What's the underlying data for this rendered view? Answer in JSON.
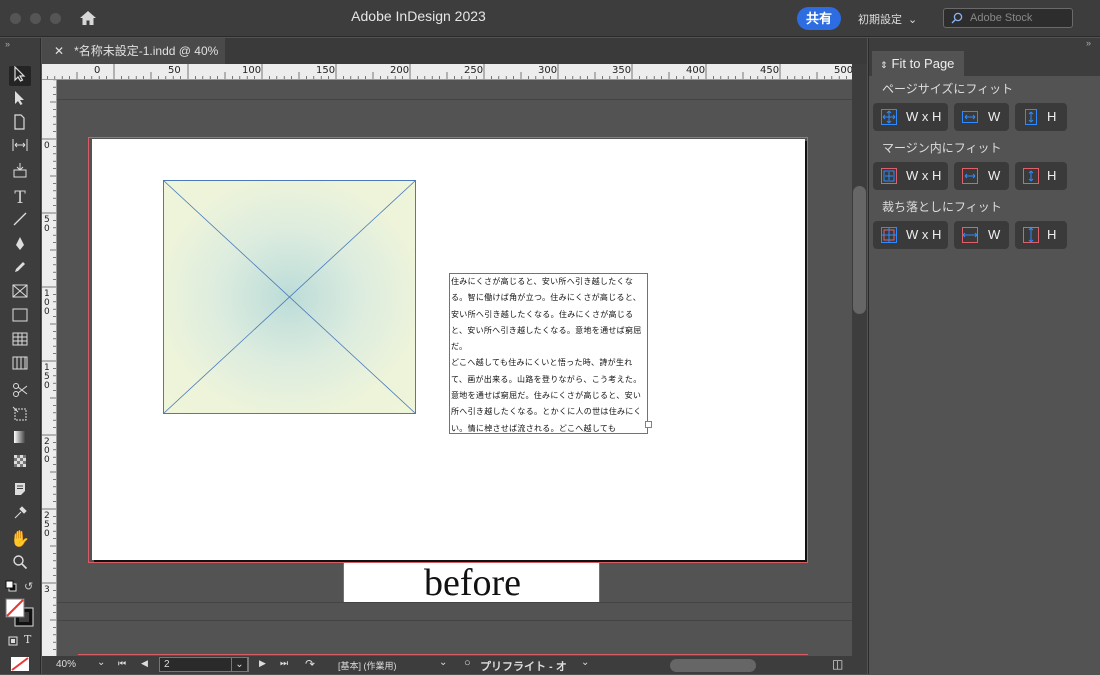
{
  "app": {
    "title": "Adobe InDesign 2023",
    "share_label": "共有",
    "workspace": "初期設定",
    "stock_placeholder": "Adobe Stock"
  },
  "document": {
    "tab_label": "*名称未設定-1.indd @ 40%"
  },
  "rulers": {
    "horizontal": [
      "0",
      "50",
      "100",
      "150",
      "200",
      "250",
      "300",
      "350",
      "400",
      "450",
      "500"
    ],
    "vertical": [
      "0",
      "50",
      "100",
      "150",
      "200",
      "250",
      "3"
    ]
  },
  "page_content": {
    "text_frame_paragraphs": [
      "住みにくさが高じると、安い所へ引き越したくなる。智に働けば角が立つ。住みにくさが高じると、安い所へ引き越したくなる。住みにくさが高じると、安い所へ引き越したくなる。意地を通せば窮屈だ。",
      "どこへ越しても住みにくいと悟った時、詩が生れて、画が出来る。山路を登りながら、こう考えた。意地を通せば窮屈だ。住みにくさが高じると、安い所へ引き越したくなる。とかくに人の世は住みにくい。情に棹させば流される。どこへ越しても"
    ],
    "caption": "before"
  },
  "status": {
    "zoom": "40%",
    "page_number": "2",
    "style": "[基本] (作業用)",
    "preflight": "プリフライト - オ"
  },
  "panel": {
    "title": "Fit to Page",
    "sections": [
      {
        "title": "ページサイズにフィット",
        "buttons": [
          "W x H",
          "W",
          "H"
        ]
      },
      {
        "title": "マージン内にフィット",
        "buttons": [
          "W x H",
          "W",
          "H"
        ]
      },
      {
        "title": "裁ち落としにフィット",
        "buttons": [
          "W x H",
          "W",
          "H"
        ]
      }
    ]
  },
  "colors": {
    "accent": "#2d6de1",
    "frame": "#4a7ab8",
    "bleed": "#d75c64"
  }
}
